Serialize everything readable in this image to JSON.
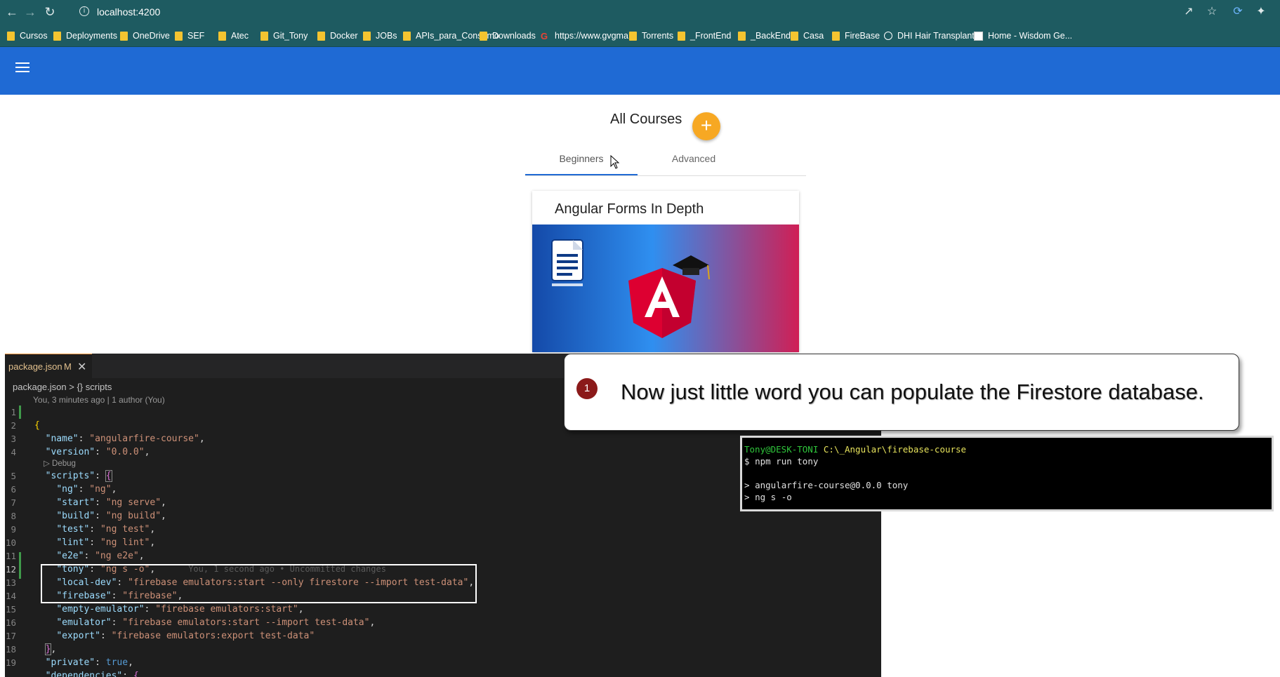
{
  "browser": {
    "url": "localhost:4200",
    "bookmarks": [
      {
        "label": "Cursos",
        "icon": "folder-icon"
      },
      {
        "label": "Deployments",
        "icon": "folder-icon"
      },
      {
        "label": "OneDrive",
        "icon": "folder-icon"
      },
      {
        "label": "SEF",
        "icon": "folder-icon"
      },
      {
        "label": "Atec",
        "icon": "folder-icon"
      },
      {
        "label": "Git_Tony",
        "icon": "folder-icon"
      },
      {
        "label": "Docker",
        "icon": "folder-icon"
      },
      {
        "label": "JOBs",
        "icon": "folder-icon"
      },
      {
        "label": "APIs_para_Consumo",
        "icon": "folder-icon"
      },
      {
        "label": "Downloads",
        "icon": "folder-icon"
      },
      {
        "label": "https://www.gvgma...",
        "icon": "google-icon"
      },
      {
        "label": "Torrents",
        "icon": "folder-icon"
      },
      {
        "label": "_FrontEnd",
        "icon": "folder-icon"
      },
      {
        "label": "_BackEnd",
        "icon": "folder-icon"
      },
      {
        "label": "Casa",
        "icon": "folder-icon"
      },
      {
        "label": "FireBase",
        "icon": "folder-icon"
      },
      {
        "label": "DHI Hair Transplant...",
        "icon": "globe-icon"
      },
      {
        "label": "Home - Wisdom Ge...",
        "icon": "site-icon"
      }
    ]
  },
  "app": {
    "title": "All Courses",
    "add_label": "+",
    "tabs": [
      {
        "label": "Beginners",
        "active": true
      },
      {
        "label": "Advanced",
        "active": false
      }
    ],
    "course": {
      "title": "Angular Forms In Depth"
    },
    "colors": {
      "toolbar": "#1f6ad4",
      "fab": "#f7a823"
    }
  },
  "editor": {
    "file_tab": "package.json",
    "file_status": "M",
    "breadcrumb_file": "package.json",
    "breadcrumb_sep": ">",
    "breadcrumb_symbol": "{} scripts",
    "blame": "You, 3 minutes ago | 1 author (You)",
    "codelens": "Debug",
    "inline_blame": "You, 1 second ago • Uncommitted changes",
    "line_numbers": [
      "1",
      "2",
      "3",
      "4",
      "5",
      "6",
      "7",
      "8",
      "9",
      "10",
      "11",
      "12",
      "13",
      "14",
      "15",
      "16",
      "17",
      "18",
      "19"
    ],
    "name_key": "\"name\"",
    "name_val": "\"angularfire-course\"",
    "version_key": "\"version\"",
    "version_val": "\"0.0.0\"",
    "scripts_key": "\"scripts\"",
    "scripts": [
      {
        "key": "\"ng\"",
        "val": "\"ng\""
      },
      {
        "key": "\"start\"",
        "val": "\"ng serve\""
      },
      {
        "key": "\"build\"",
        "val": "\"ng build\""
      },
      {
        "key": "\"test\"",
        "val": "\"ng test\""
      },
      {
        "key": "\"lint\"",
        "val": "\"ng lint\""
      },
      {
        "key": "\"e2e\"",
        "val": "\"ng e2e\""
      },
      {
        "key": "\"tony\"",
        "val": "\"ng s -o\""
      },
      {
        "key": "\"local-dev\"",
        "val": "\"firebase emulators:start --only firestore --import test-data\""
      },
      {
        "key": "\"firebase\"",
        "val": "\"firebase\""
      },
      {
        "key": "\"empty-emulator\"",
        "val": "\"firebase emulators:start\""
      },
      {
        "key": "\"emulator\"",
        "val": "\"firebase emulators:start --import test-data\""
      },
      {
        "key": "\"export\"",
        "val": "\"firebase emulators:export test-data\""
      }
    ],
    "private_key": "\"private\"",
    "private_val": "true",
    "deps_key": "\"dependencies\""
  },
  "callout": {
    "number": "1",
    "text": "Now just little word you can populate the Firestore database."
  },
  "terminal": {
    "user": "Tony@DESK-TONI",
    "path": "C:\\_Angular\\firebase-course",
    "prompt": "$",
    "command": "npm run tony",
    "out1_marker": ">",
    "out1": "angularfire-course@0.0.0 tony",
    "out2_marker": ">",
    "out2": "ng s -o"
  }
}
